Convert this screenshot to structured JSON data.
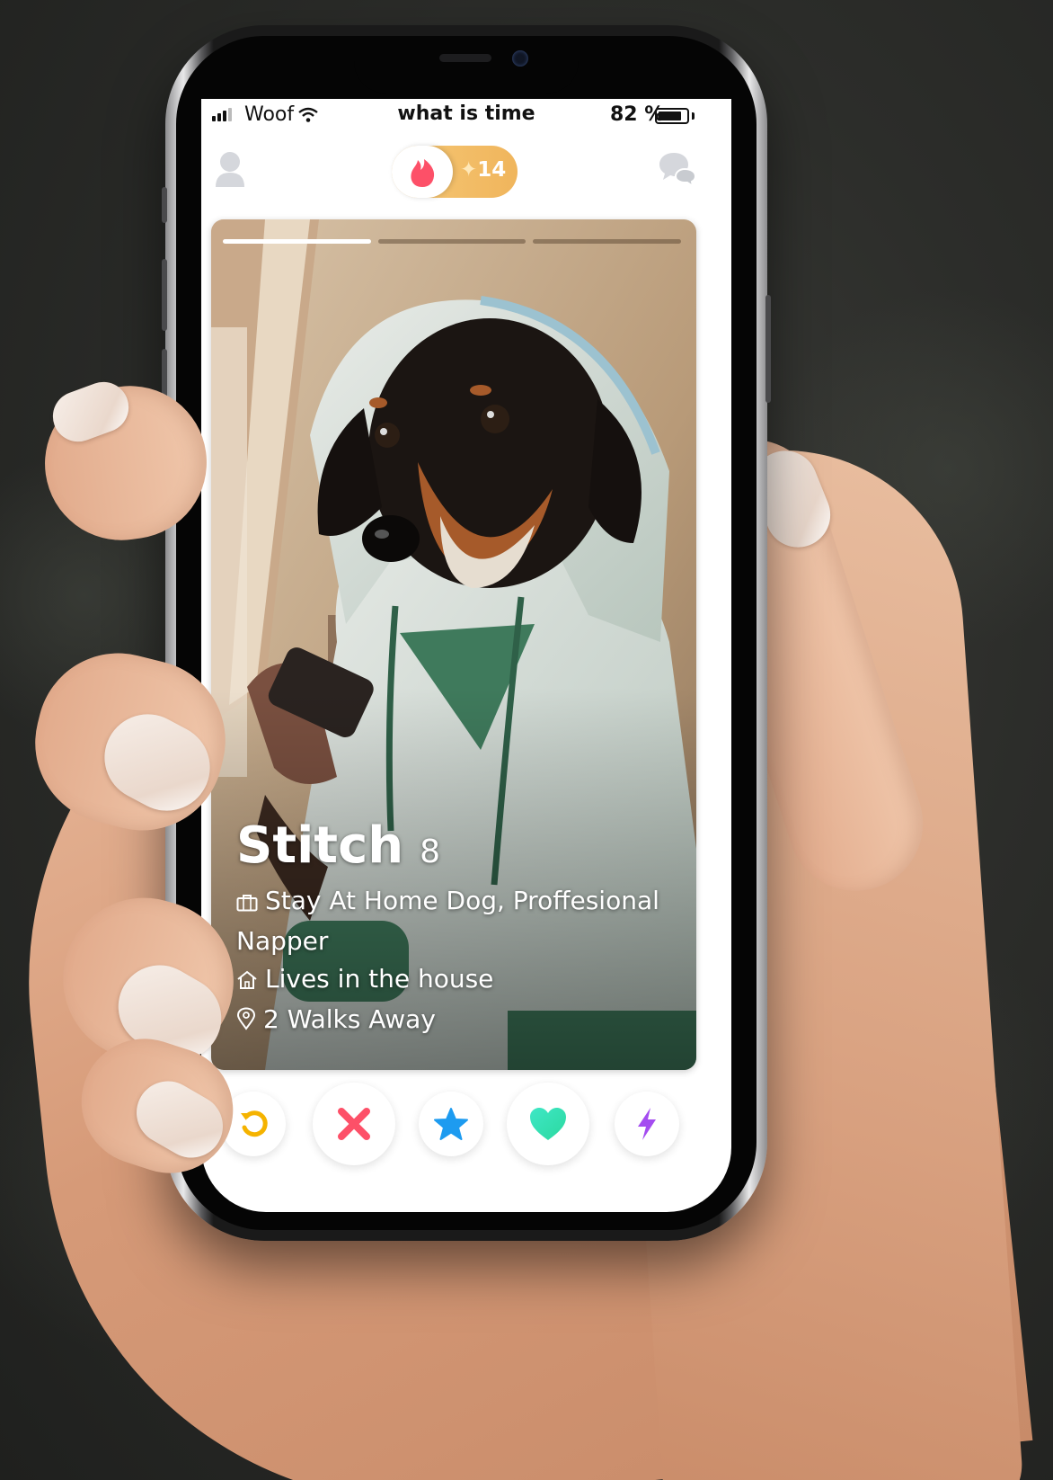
{
  "status_bar": {
    "carrier": "Woof",
    "time": "what is time",
    "battery_percent": "82 %",
    "battery_level": 0.82
  },
  "top_nav": {
    "super_like_count": "14",
    "icons": [
      "profile-icon",
      "flame-icon",
      "sparkle-icon",
      "chat-icon"
    ]
  },
  "profile_card": {
    "photo_count": 3,
    "active_photo": 1,
    "name": "Stitch",
    "age": "8",
    "job": "Stay At Home Dog, Proffesional Napper",
    "residence": "Lives in the house",
    "distance": "2 Walks Away"
  },
  "action_bar": {
    "buttons": [
      "rewind-button",
      "nope-button",
      "super-like-button",
      "like-button",
      "boost-button"
    ]
  },
  "colors": {
    "brand_flame": "#fd5068",
    "gold": "#f0b55c",
    "rewind": "#f5b300",
    "nope": "#fd5068",
    "super_like": "#1d9bf0",
    "like": "#2ee6b0",
    "boost": "#a44cf0"
  }
}
